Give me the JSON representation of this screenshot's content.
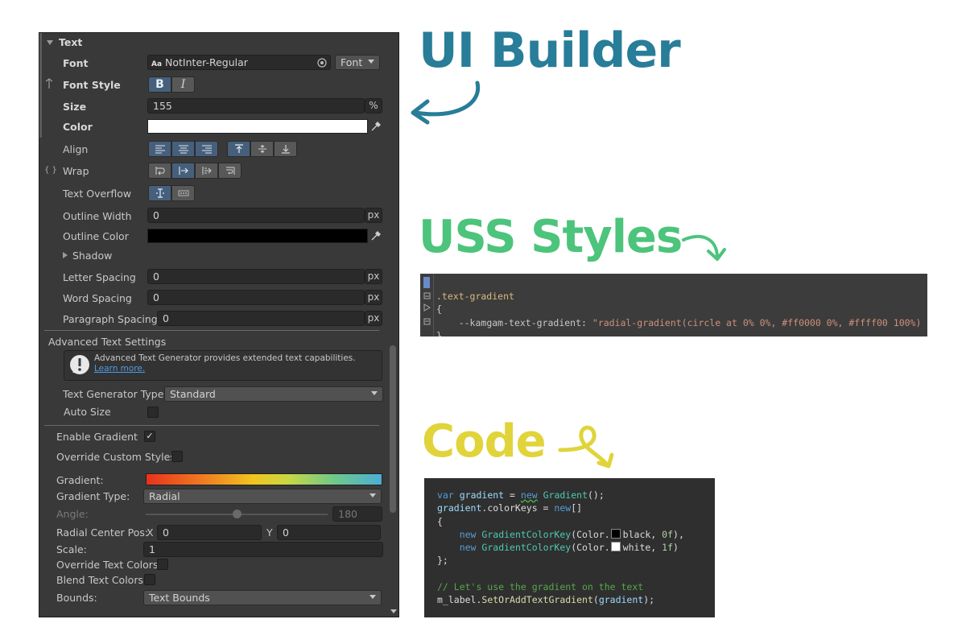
{
  "headings": {
    "ui_builder": "UI Builder",
    "uss_styles": "USS Styles",
    "code": "Code"
  },
  "colors": {
    "ui_builder": "#287d98",
    "uss_styles": "#4cc47b",
    "code": "#e0d43a",
    "panel_bg": "#393939",
    "toggle_on": "#46607c"
  },
  "inspector": {
    "section_title": "Text",
    "font": {
      "label": "Font",
      "value": "NotInter-Regular",
      "icon_text": "Aa",
      "dropdown": "Font"
    },
    "font_style": {
      "label": "Font Style",
      "bold": "B",
      "italic": "I"
    },
    "size": {
      "label": "Size",
      "value": "155",
      "unit": "%"
    },
    "color": {
      "label": "Color",
      "value": "#ffffff"
    },
    "align": {
      "label": "Align"
    },
    "wrap": {
      "label": "Wrap",
      "side_icon": "{ }"
    },
    "text_overflow": {
      "label": "Text Overflow"
    },
    "outline_width": {
      "label": "Outline Width",
      "value": "0",
      "unit": "px"
    },
    "outline_color": {
      "label": "Outline Color",
      "value": "#000000"
    },
    "shadow": {
      "label": "Shadow"
    },
    "letter_spacing": {
      "label": "Letter Spacing",
      "value": "0",
      "unit": "px"
    },
    "word_spacing": {
      "label": "Word Spacing",
      "value": "0",
      "unit": "px"
    },
    "paragraph_spacing": {
      "label": "Paragraph Spacing",
      "value": "0",
      "unit": "px"
    },
    "advanced": {
      "title": "Advanced Text Settings",
      "info_text": "Advanced Text Generator provides extended text capabilities.",
      "info_link": "Learn more.",
      "generator_type": {
        "label": "Text Generator Type",
        "value": "Standard"
      },
      "auto_size": {
        "label": "Auto Size"
      }
    },
    "gradient": {
      "enable": {
        "label": "Enable Gradient",
        "checked": "✓"
      },
      "override_custom": {
        "label": "Override Custom Styles"
      },
      "gradient_label": "Gradient:",
      "type": {
        "label": "Gradient Type:",
        "value": "Radial"
      },
      "angle": {
        "label": "Angle:",
        "value": "180"
      },
      "radial_center": {
        "label": "Radial Center Pos:",
        "x_label": "X",
        "x_value": "0",
        "y_label": "Y",
        "y_value": "0"
      },
      "scale": {
        "label": "Scale:",
        "value": "1"
      },
      "override_text_colors": {
        "label": "Override Text Colors"
      },
      "blend_text_colors": {
        "label": "Blend Text Colors"
      },
      "bounds": {
        "label": "Bounds:",
        "value": "Text Bounds"
      }
    }
  },
  "uss_code": {
    "selector": ".text-gradient",
    "open": "{",
    "property": "--kamgam-text-gradient:",
    "value": "\"radial-gradient(circle at 0% 0%, #ff0000 0%, #ffff00 100%)",
    "close": "}"
  },
  "csharp_code": {
    "l1_kw": "var",
    "l1_var": "gradient",
    "l1_eq": " = ",
    "l1_new": "new",
    "l1_type": "Gradient",
    "l1_end": "();",
    "l2_var": "gradient",
    "l2_prop": ".colorKeys = ",
    "l2_new": "new",
    "l2_end": "[]",
    "l3": "{",
    "l4_new": "new",
    "l4_type": "GradientColorKey",
    "l4_color": "(Color.",
    "l4_val": "black",
    "l4_num": "0f",
    "l4_end": "),",
    "l5_new": "new",
    "l5_type": "GradientColorKey",
    "l5_color": "(Color.",
    "l5_val": "white",
    "l5_num": "1f",
    "l5_end": ")",
    "l6": "};",
    "l7_comment": "// Let's use the gradient on the text",
    "l8_obj": "m_label.",
    "l8_method": "SetOrAddTextGradient",
    "l8_open": "(",
    "l8_arg": "gradient",
    "l8_end": ");"
  }
}
